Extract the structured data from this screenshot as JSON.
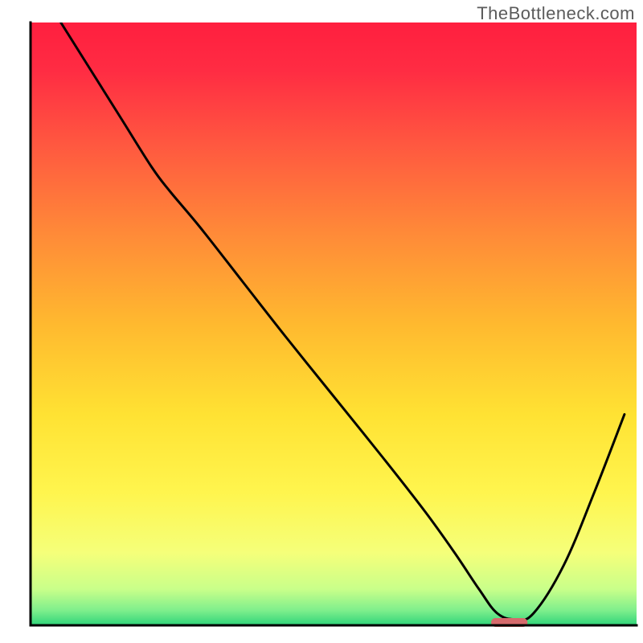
{
  "watermark": "TheBottleneck.com",
  "chart_data": {
    "type": "line",
    "title": "",
    "xlabel": "",
    "ylabel": "",
    "xlim": [
      0,
      100
    ],
    "ylim": [
      0,
      100
    ],
    "grid": false,
    "legend": false,
    "background_gradient_stops": [
      {
        "offset": 0.0,
        "color": "#ff1f3f"
      },
      {
        "offset": 0.08,
        "color": "#ff2c43"
      },
      {
        "offset": 0.2,
        "color": "#ff5740"
      },
      {
        "offset": 0.35,
        "color": "#ff8a38"
      },
      {
        "offset": 0.5,
        "color": "#ffb92f"
      },
      {
        "offset": 0.65,
        "color": "#ffe233"
      },
      {
        "offset": 0.78,
        "color": "#fff54e"
      },
      {
        "offset": 0.88,
        "color": "#f5ff7a"
      },
      {
        "offset": 0.94,
        "color": "#c9ff8a"
      },
      {
        "offset": 0.975,
        "color": "#7fef8c"
      },
      {
        "offset": 1.0,
        "color": "#2fd47a"
      }
    ],
    "series": [
      {
        "name": "bottleneck-curve",
        "x": [
          5,
          10,
          15,
          20,
          23,
          28,
          35,
          42,
          50,
          58,
          65,
          70,
          74,
          77,
          80,
          83,
          88,
          93,
          98
        ],
        "values": [
          100,
          92,
          84,
          76,
          72,
          66,
          57,
          48,
          38,
          28,
          19,
          12,
          6,
          2,
          1,
          2,
          10,
          22,
          35
        ]
      }
    ],
    "marker": {
      "name": "optimum-marker",
      "x": 79,
      "y": 0.6,
      "width": 6,
      "color": "#d66a6c",
      "shape": "rounded-bar"
    }
  }
}
